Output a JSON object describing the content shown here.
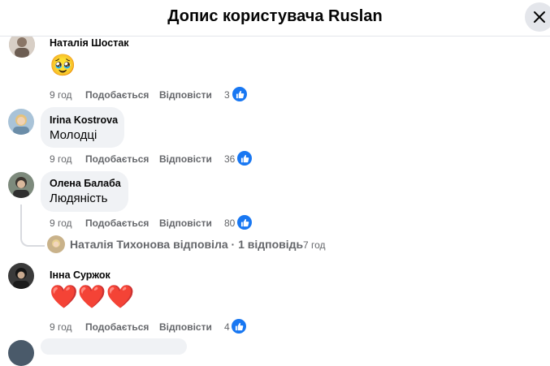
{
  "header": {
    "title": "Допис користувача Ruslan",
    "close_icon": "close-icon"
  },
  "labels": {
    "like": "Подобається",
    "reply": "Відповісти"
  },
  "comments": [
    {
      "author": "Наталія Шостак",
      "emoji": "🥹",
      "time": "9 год",
      "reactions": "3"
    },
    {
      "author": "Irina Kostrova",
      "text": "Молодці",
      "time": "9 год",
      "reactions": "36"
    },
    {
      "author": "Олена Балаба",
      "text": "Людяність",
      "time": "9 год",
      "reactions": "80",
      "replies_summary": {
        "text": "Наталія Тихонова відповіла · 1 відповідь",
        "time": "7 год"
      }
    },
    {
      "author": "Інна Суржок",
      "emoji": "❤️❤️❤️",
      "time": "9 год",
      "reactions": "4"
    }
  ],
  "colors": {
    "like_blue": "#1877f2",
    "meta_gray": "#65676b",
    "bubble": "#f0f2f5"
  }
}
